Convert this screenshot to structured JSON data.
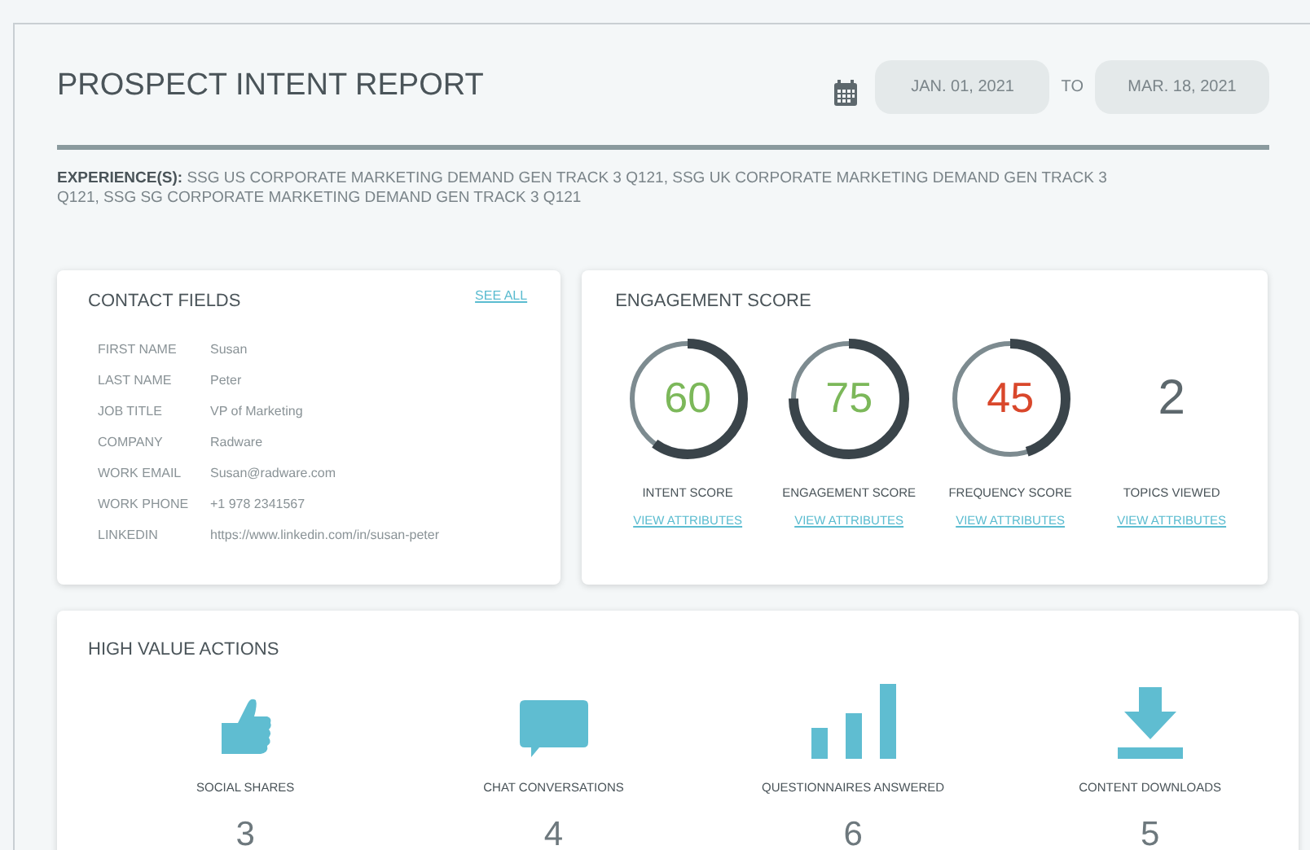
{
  "report": {
    "title": "PROSPECT INTENT REPORT",
    "date_from": "JAN. 01, 2021",
    "date_to_label": "TO",
    "date_to": "MAR. 18, 2021",
    "experiences_label": "EXPERIENCE(S):",
    "experiences": "SSG US CORPORATE MARKETING DEMAND GEN TRACK 3 Q121, SSG UK CORPORATE MARKETING DEMAND GEN TRACK 3 Q121, SSG SG CORPORATE MARKETING DEMAND GEN TRACK 3 Q121"
  },
  "contact_fields": {
    "title": "CONTACT FIELDS",
    "see_all": "SEE ALL",
    "fields": [
      {
        "label": "FIRST NAME",
        "value": "Susan"
      },
      {
        "label": "LAST NAME",
        "value": "Peter"
      },
      {
        "label": "JOB TITLE",
        "value": "VP of Marketing"
      },
      {
        "label": "COMPANY",
        "value": "Radware"
      },
      {
        "label": "WORK EMAIL",
        "value": "Susan@radware.com"
      },
      {
        "label": "WORK PHONE",
        "value": "+1 978 2341567"
      },
      {
        "label": "LINKEDIN",
        "value": "https://www.linkedin.com/in/susan-peter"
      }
    ]
  },
  "engagement_score": {
    "title": "ENGAGEMENT SCORE",
    "scores": [
      {
        "kind": "gauge",
        "value": "60",
        "color": "#7cb85a",
        "label": "INTENT SCORE",
        "link": "VIEW ATTRIBUTES"
      },
      {
        "kind": "gauge",
        "value": "75",
        "color": "#7cb85a",
        "label": "ENGAGEMENT SCORE",
        "link": "VIEW ATTRIBUTES"
      },
      {
        "kind": "gauge",
        "value": "45",
        "color": "#d9472b",
        "label": "FREQUENCY SCORE",
        "link": "VIEW ATTRIBUTES"
      },
      {
        "kind": "count",
        "value": "2",
        "label": "TOPICS VIEWED",
        "link": "VIEW ATTRIBUTES"
      }
    ]
  },
  "high_value_actions": {
    "title": "HIGH VALUE ACTIONS",
    "actions": [
      {
        "kind": "thumbs",
        "label": "SOCIAL SHARES",
        "count": "3"
      },
      {
        "kind": "chat",
        "label": "CHAT CONVERSATIONS",
        "count": "4"
      },
      {
        "kind": "bars",
        "label": "QUESTIONNAIRES ANSWERED",
        "count": "6"
      },
      {
        "kind": "download",
        "label": "CONTENT DOWNLOADS",
        "count": "5"
      }
    ]
  }
}
